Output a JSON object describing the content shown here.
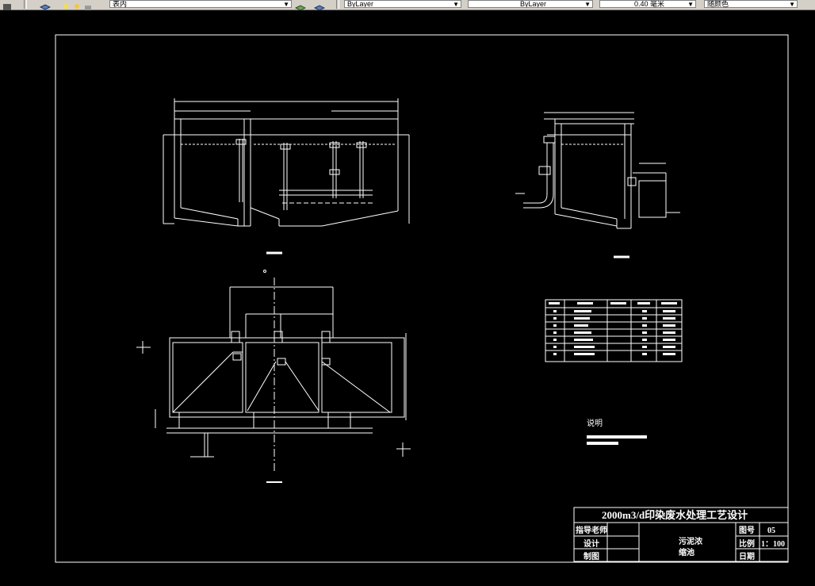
{
  "toolbar": {
    "layer_name": "表内",
    "color_value": "ByLayer",
    "linetype_value": "ByLayer",
    "lineweight_value": "0.40 毫米",
    "plotstyle_value": "随颜色"
  },
  "drawing": {
    "notes_heading": "说明",
    "title_block": {
      "project_title": "2000m3/d印染废水处理工艺设计",
      "advisor_label": "指导老师",
      "design_label": "设计",
      "drafting_label": "制图",
      "drawing_name_line1": "污泥浓",
      "drawing_name_line2": "缩池",
      "drawing_no_label": "图号",
      "drawing_no_value": "05",
      "scale_label": "比例",
      "scale_value": "1：100",
      "date_label": "日期"
    }
  },
  "colors": {
    "background": "#000000",
    "line": "#ffffff",
    "toolbar": "#d4d0c8"
  }
}
